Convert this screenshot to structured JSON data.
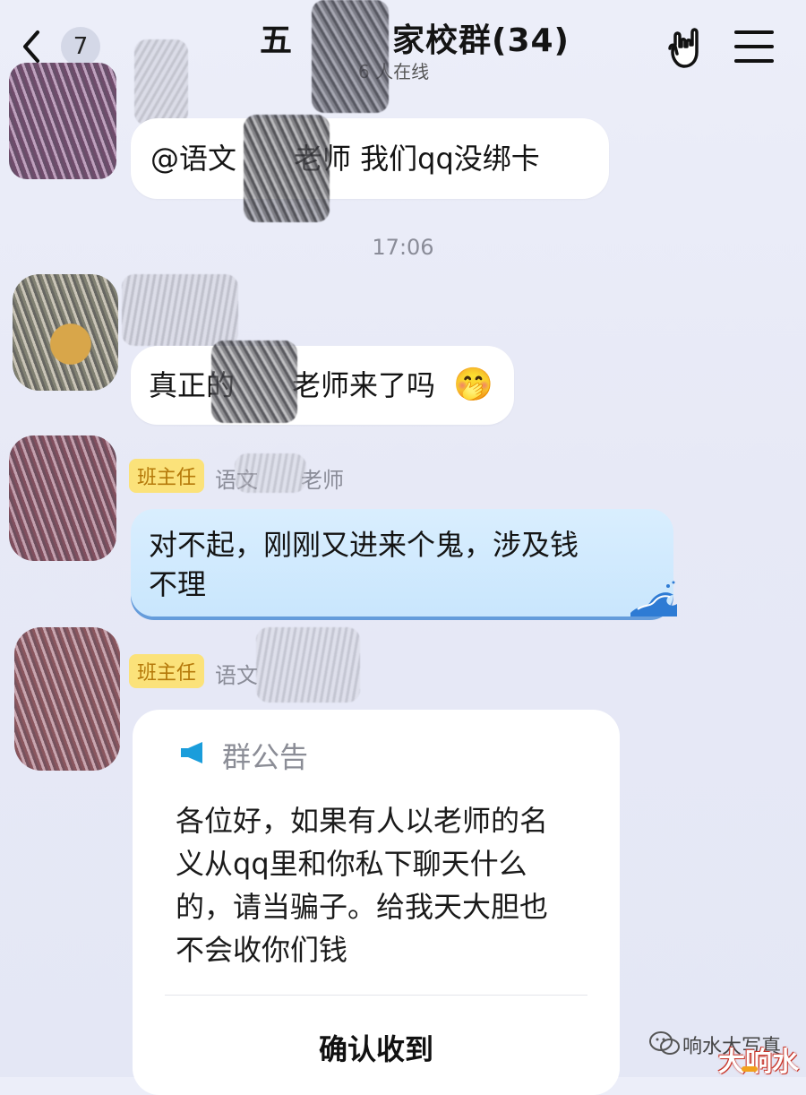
{
  "header": {
    "unread_count": "7",
    "title": "五　　　家校群(34)",
    "online_status": "6 人在线",
    "back_icon": "chevron-left-icon",
    "gesture_icon": "rock-hand-icon",
    "menu_icon": "hamburger-menu-icon"
  },
  "messages": [
    {
      "text": "@语文　　老师 我们qq没绑卡"
    },
    {
      "text": "真正的　　老师来了吗"
    },
    {
      "role_badge": "班主任",
      "sender": "语文　　老师",
      "text_line1": "对不起，刚刚又进来个鬼，涉及钱",
      "text_line2": "不理"
    },
    {
      "role_badge": "班主任",
      "sender": "语文",
      "notice": {
        "title": "群公告",
        "icon": "megaphone-icon",
        "lines": [
          "各位好，如果有人以老师的名",
          "义从qq里和你私下聊天什么",
          "的，请当骗子。给我天大胆也",
          "不会收你们钱"
        ],
        "confirm_label": "确认收到"
      }
    }
  ],
  "timestamp": "17:06",
  "emoji": "🤭",
  "watermark": {
    "text": "响水大写真",
    "logo_text": "大响水"
  },
  "colors": {
    "background": "#e8eaf7",
    "bubble": "#ffffff",
    "blue_bubble": "#cfe8fd",
    "role_badge": "#fbe27a"
  }
}
